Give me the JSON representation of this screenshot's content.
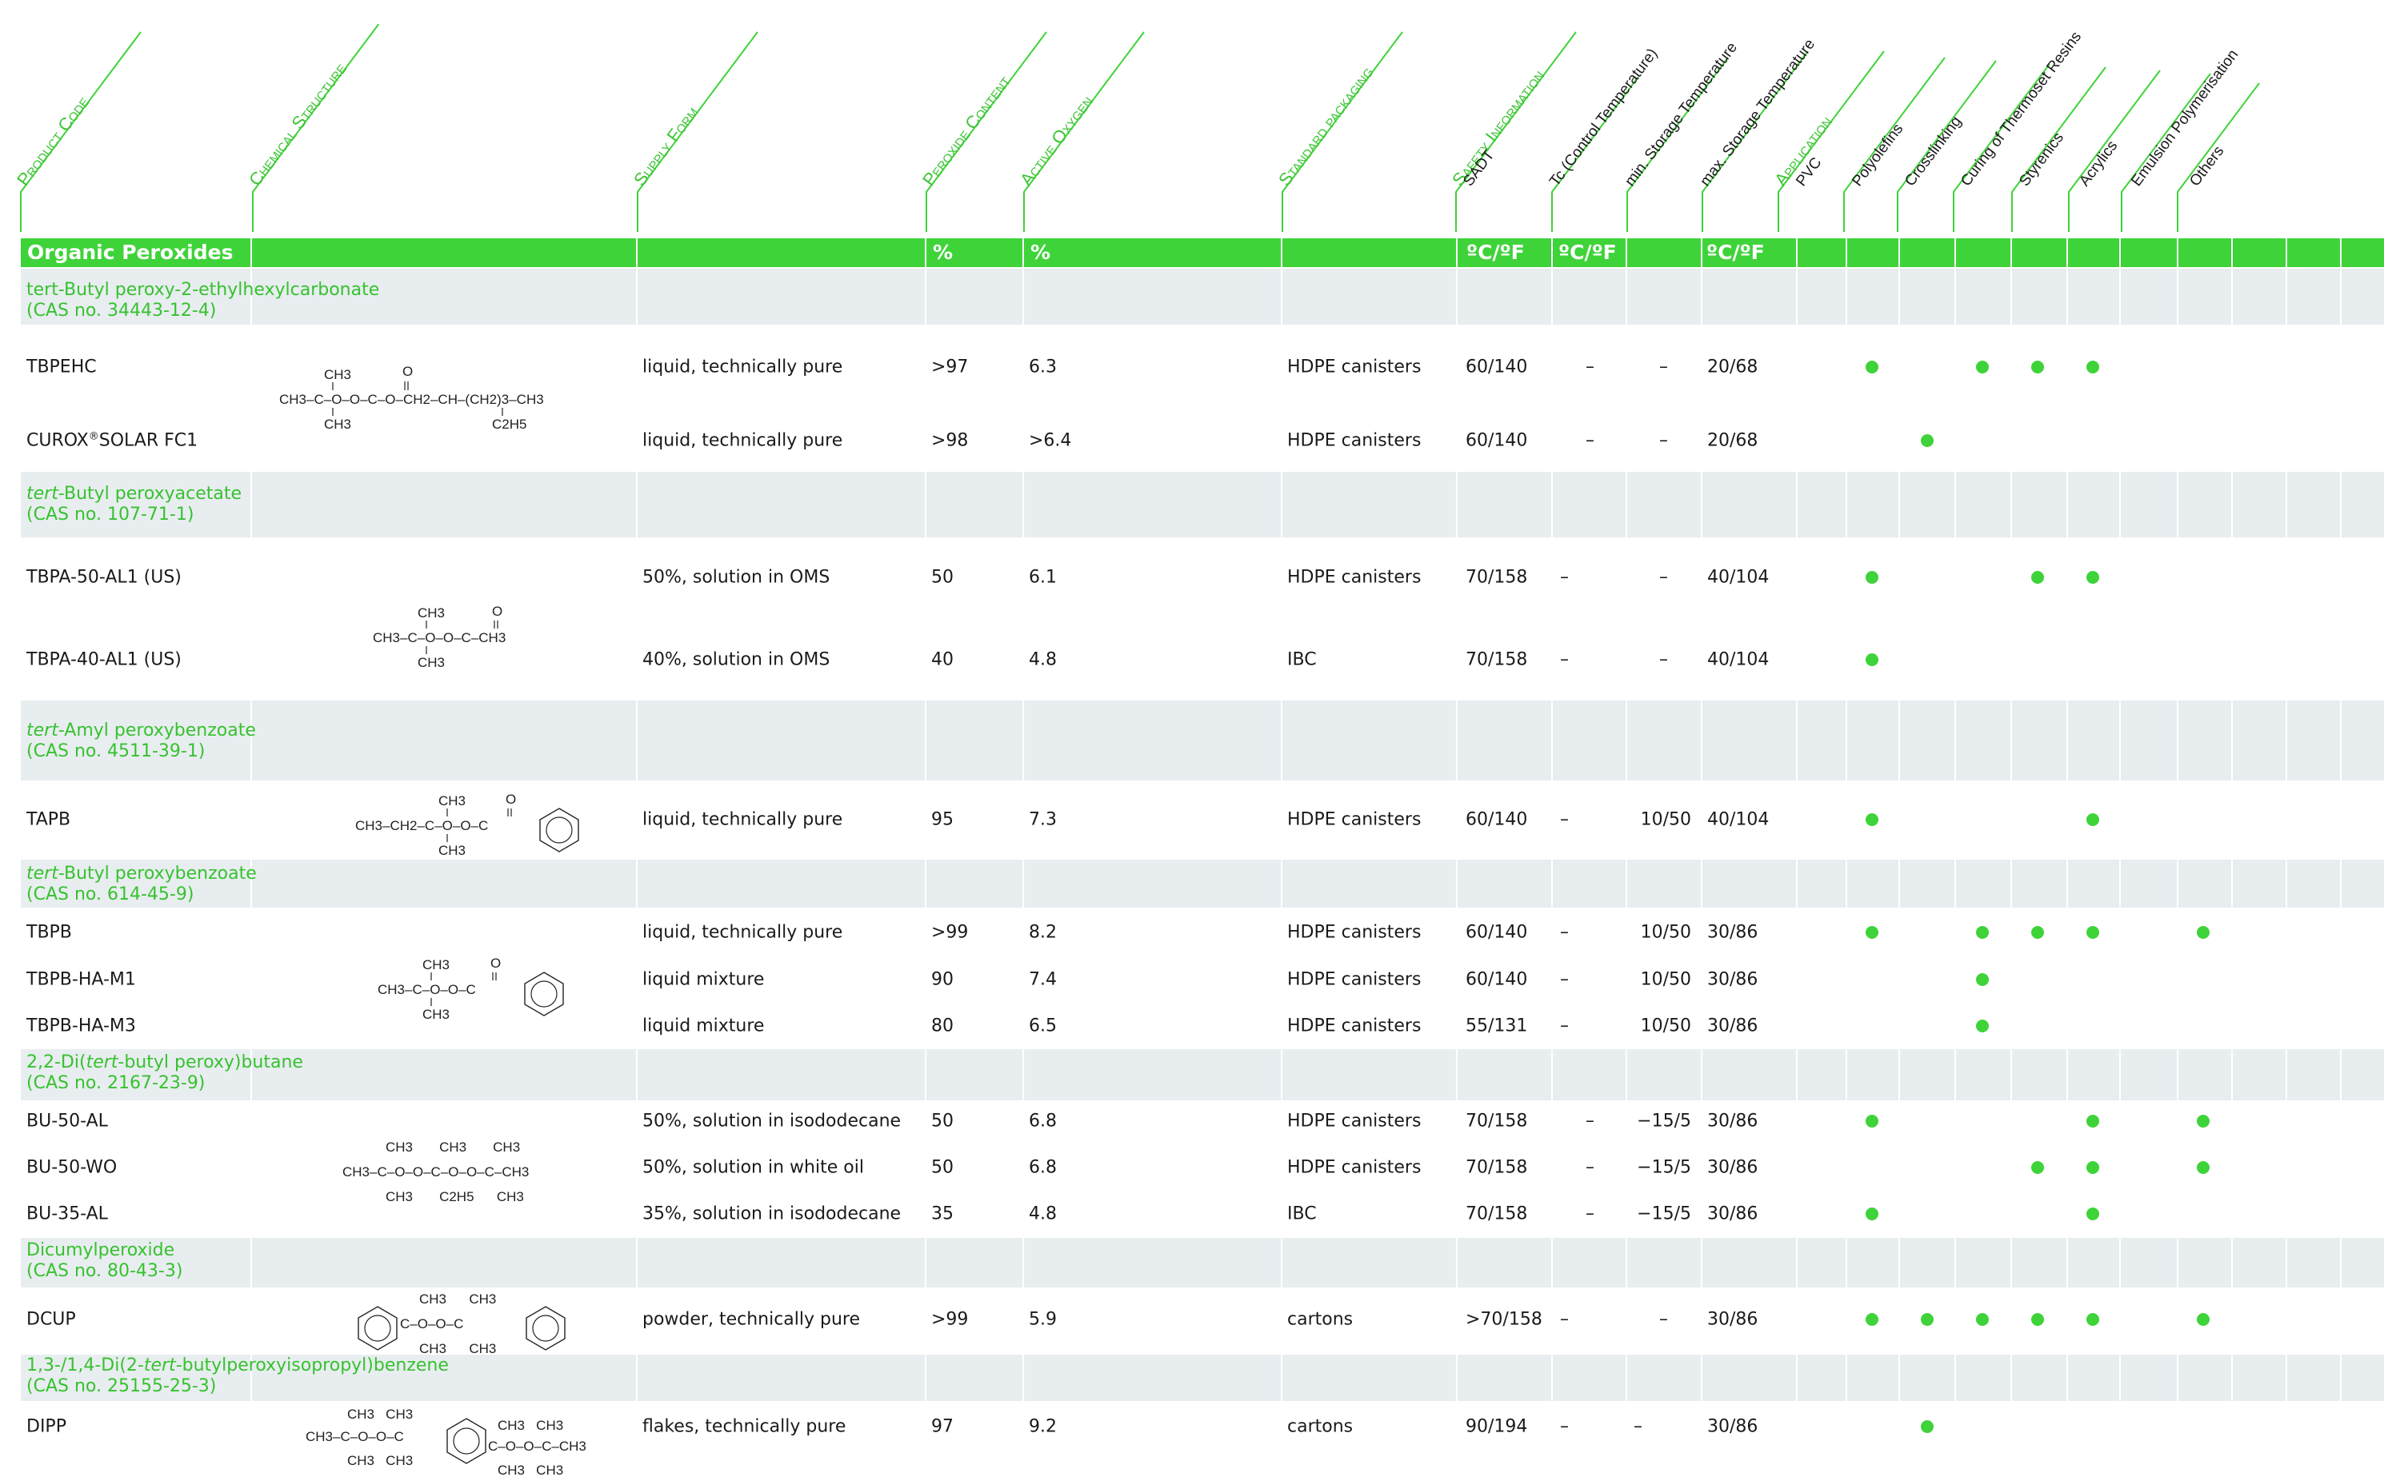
{
  "headers": {
    "product_code": "Product Code",
    "chemical_structure": "Chemical Structure",
    "supply_form": "Supply Form",
    "peroxide_content": "Peroxide Content",
    "active_oxygen": "Active Oxygen",
    "standard_packaging": "Standard packaging",
    "safety_information": "Safety Information",
    "sadt": "SADT",
    "tc": "Tc (Control Temperature)",
    "min_storage": "min. Storage Temperature",
    "max_storage": "max. Storage Temperature",
    "application": "Application",
    "apps": [
      "PVC",
      "Polyolefins",
      "Crosslinking",
      "Curing of Thermoset Resins",
      "Styrenics",
      "Acrylics",
      "Emulsion Polymerisation",
      "Others"
    ]
  },
  "bar": {
    "title": "Organic Peroxides",
    "pct1": "%",
    "pct2": "%",
    "unit1": "ºC/ºF",
    "unit2": "ºC/ºF",
    "unit3": "ºC/ºF"
  },
  "groups": [
    {
      "name_pre": "",
      "name_it": "",
      "name_post": "tert-Butyl peroxy-2-ethylhexylcarbonate",
      "cas": "(CAS no. 34443-12-4)"
    },
    {
      "name_pre": "",
      "name_it": "tert",
      "name_post": "-Butyl peroxyacetate",
      "cas": "(CAS no. 107-71-1)"
    },
    {
      "name_pre": "",
      "name_it": "tert",
      "name_post": "-Amyl peroxybenzoate",
      "cas": "(CAS no. 4511-39-1)"
    },
    {
      "name_pre": "",
      "name_it": "tert",
      "name_post": "-Butyl peroxybenzoate",
      "cas": "(CAS no. 614-45-9)"
    },
    {
      "name_pre": "2,2-Di(",
      "name_it": "tert",
      "name_post": "-butyl peroxy)butane",
      "cas": "(CAS no. 2167-23-9)"
    },
    {
      "name_pre": "",
      "name_it": "",
      "name_post": "Dicumylperoxide",
      "cas": "(CAS no. 80-43-3)"
    },
    {
      "name_pre": "1,3-/1,4-Di(2-",
      "name_it": "tert",
      "name_post": "-butylperoxyisopropyl)benzene",
      "cas": "(CAS no. 25155-25-3)"
    }
  ],
  "rows": [
    {
      "code": "TBPEHC",
      "code_sup": "",
      "code_post": "",
      "supply": "liquid, technically pure",
      "peroxide": ">97",
      "oxygen": "6.3",
      "packaging": "HDPE canisters",
      "sadt": "60/140",
      "tc": "–",
      "min": "–",
      "max": "20/68",
      "apps": [
        true,
        false,
        true,
        true,
        true,
        false,
        false,
        false
      ]
    },
    {
      "code": "CUROX",
      "code_sup": "®",
      "code_post": "SOLAR FC1",
      "supply": "liquid, technically pure",
      "peroxide": ">98",
      "oxygen": ">6.4",
      "packaging": "HDPE canisters",
      "sadt": "60/140",
      "tc": "–",
      "min": "–",
      "max": "20/68",
      "apps": [
        false,
        true,
        false,
        false,
        false,
        false,
        false,
        false
      ]
    },
    {
      "code": "TBPA-50-AL1 (US)",
      "code_sup": "",
      "code_post": "",
      "supply": "50%, solution in OMS",
      "peroxide": "50",
      "oxygen": "6.1",
      "packaging": "HDPE canisters",
      "sadt": "70/158",
      "tc": "–",
      "min": "–",
      "max": "40/104",
      "apps": [
        true,
        false,
        false,
        true,
        true,
        false,
        false,
        false
      ]
    },
    {
      "code": "TBPA-40-AL1 (US)",
      "code_sup": "",
      "code_post": "",
      "supply": "40%, solution in OMS",
      "peroxide": "40",
      "oxygen": "4.8",
      "packaging": "IBC",
      "sadt": "70/158",
      "tc": "–",
      "min": "–",
      "max": "40/104",
      "apps": [
        true,
        false,
        false,
        false,
        false,
        false,
        false,
        false
      ]
    },
    {
      "code": "TAPB",
      "code_sup": "",
      "code_post": "",
      "supply": "liquid, technically pure",
      "peroxide": "95",
      "oxygen": "7.3",
      "packaging": "HDPE canisters",
      "sadt": "60/140",
      "tc": "–",
      "min": "10/50",
      "max": "40/104",
      "apps": [
        true,
        false,
        false,
        false,
        true,
        false,
        false,
        false
      ]
    },
    {
      "code": "TBPB",
      "code_sup": "",
      "code_post": "",
      "supply": "liquid, technically pure",
      "peroxide": ">99",
      "oxygen": "8.2",
      "packaging": "HDPE canisters",
      "sadt": "60/140",
      "tc": "–",
      "min": "10/50",
      "max": "30/86",
      "apps": [
        true,
        false,
        true,
        true,
        true,
        false,
        true,
        false
      ]
    },
    {
      "code": "TBPB-HA-M1",
      "code_sup": "",
      "code_post": "",
      "supply": "liquid mixture",
      "peroxide": "90",
      "oxygen": "7.4",
      "packaging": "HDPE canisters",
      "sadt": "60/140",
      "tc": "–",
      "min": "10/50",
      "max": "30/86",
      "apps": [
        false,
        false,
        true,
        false,
        false,
        false,
        false,
        false
      ]
    },
    {
      "code": "TBPB-HA-M3",
      "code_sup": "",
      "code_post": "",
      "supply": "liquid mixture",
      "peroxide": "80",
      "oxygen": "6.5",
      "packaging": "HDPE canisters",
      "sadt": "55/131",
      "tc": "–",
      "min": "10/50",
      "max": "30/86",
      "apps": [
        false,
        false,
        true,
        false,
        false,
        false,
        false,
        false
      ]
    },
    {
      "code": "BU-50-AL",
      "code_sup": "",
      "code_post": "",
      "supply": "50%, solution in isododecane",
      "peroxide": "50",
      "oxygen": "6.8",
      "packaging": "HDPE canisters",
      "sadt": "70/158",
      "tc": "–",
      "min": "−15/5",
      "max": "30/86",
      "apps": [
        true,
        false,
        false,
        false,
        true,
        false,
        true,
        false
      ]
    },
    {
      "code": "BU-50-WO",
      "code_sup": "",
      "code_post": "",
      "supply": "50%, solution in white oil",
      "peroxide": "50",
      "oxygen": "6.8",
      "packaging": "HDPE canisters",
      "sadt": "70/158",
      "tc": "–",
      "min": "−15/5",
      "max": "30/86",
      "apps": [
        false,
        false,
        false,
        true,
        true,
        false,
        true,
        false
      ]
    },
    {
      "code": "BU-35-AL",
      "code_sup": "",
      "code_post": "",
      "supply": "35%, solution in isododecane",
      "peroxide": "35",
      "oxygen": "4.8",
      "packaging": "IBC",
      "sadt": "70/158",
      "tc": "–",
      "min": "−15/5",
      "max": "30/86",
      "apps": [
        true,
        false,
        false,
        false,
        true,
        false,
        false,
        false
      ]
    },
    {
      "code": "DCUP",
      "code_sup": "",
      "code_post": "",
      "supply": "powder, technically pure",
      "peroxide": ">99",
      "oxygen": "5.9",
      "packaging": "cartons",
      "sadt": ">70/158",
      "tc": "–",
      "min": "–",
      "max": "30/86",
      "apps": [
        true,
        true,
        true,
        true,
        true,
        false,
        true,
        false
      ]
    },
    {
      "code": "DIPP",
      "code_sup": "",
      "code_post": "",
      "supply": "flakes, technically pure",
      "peroxide": "97",
      "oxygen": "9.2",
      "packaging": "cartons",
      "sadt": "90/194",
      "tc": "–",
      "min": "–",
      "max": "30/86",
      "apps": [
        false,
        true,
        false,
        false,
        false,
        false,
        false,
        false
      ]
    }
  ],
  "structures": {
    "s1": {
      "ch3_top": "CH3",
      "o_top": "O",
      "main": "CH3–C–O–O–C–O–CH2–CH–(CH2)3–CH3",
      "ch3_bottom": "CH3",
      "c2h5": "C2H5"
    },
    "s2": {
      "ch3_top": "CH3",
      "o_top": "O",
      "main": "CH3–C–O–O–C–CH3",
      "ch3_bottom": "CH3"
    },
    "s3": {
      "ch3_top": "CH3",
      "o_top": "O",
      "main": "CH3–CH2–C–O–O–C",
      "ch3_bottom": "CH3"
    },
    "s4": {
      "ch3_top": "CH3",
      "o_top": "O",
      "main": "CH3–C–O–O–C",
      "ch3_bottom": "CH3"
    },
    "s5": {
      "top": "CH3       CH3       CH3",
      "main": "CH3–C–O–O–C–O–O–C–CH3",
      "bottom": "CH3       C2H5      CH3"
    },
    "s6": {
      "top": "CH3      CH3",
      "main": "C–O–O–C",
      "bottom": "CH3      CH3"
    },
    "s7": {
      "top": "CH3   CH3",
      "main": "CH3–C–O–O–C",
      "bottom": "CH3   CH3",
      "right_top": "CH3   CH3",
      "right_main": "C–O–O–C–CH3",
      "right_bottom": "CH3   CH3"
    }
  }
}
